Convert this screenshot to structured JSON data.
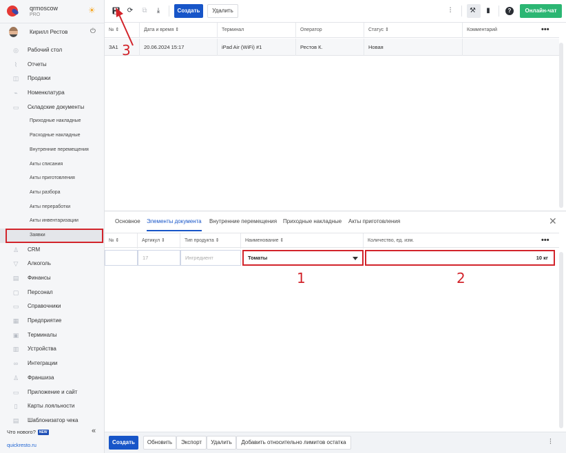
{
  "brand": {
    "name": "qrmoscow",
    "plan": "PRO"
  },
  "user": {
    "name": "Кирилл Рестов"
  },
  "sidebar": {
    "items": [
      {
        "label": "Рабочий стол",
        "icon": "◎",
        "sub": false
      },
      {
        "label": "Отчеты",
        "icon": "⌇",
        "sub": false
      },
      {
        "label": "Продажи",
        "icon": "◫",
        "sub": false
      },
      {
        "label": "Номенклатура",
        "icon": "⌁",
        "sub": false
      },
      {
        "label": "Складские документы",
        "icon": "▭",
        "sub": false
      },
      {
        "label": "Приходные накладные",
        "icon": "",
        "sub": true
      },
      {
        "label": "Расходные накладные",
        "icon": "",
        "sub": true
      },
      {
        "label": "Внутренние перемещения",
        "icon": "",
        "sub": true
      },
      {
        "label": "Акты списания",
        "icon": "",
        "sub": true
      },
      {
        "label": "Акты приготовления",
        "icon": "",
        "sub": true
      },
      {
        "label": "Акты разбора",
        "icon": "",
        "sub": true
      },
      {
        "label": "Акты переработки",
        "icon": "",
        "sub": true
      },
      {
        "label": "Акты инвентаризации",
        "icon": "",
        "sub": true
      },
      {
        "label": "Заявки",
        "icon": "",
        "sub": true,
        "active": true
      },
      {
        "label": "CRM",
        "icon": "♙",
        "sub": false
      },
      {
        "label": "Алкоголь",
        "icon": "▽",
        "sub": false
      },
      {
        "label": "Финансы",
        "icon": "▤",
        "sub": false
      },
      {
        "label": "Персонал",
        "icon": "▢",
        "sub": false
      },
      {
        "label": "Справочники",
        "icon": "▭",
        "sub": false
      },
      {
        "label": "Предприятие",
        "icon": "▦",
        "sub": false
      },
      {
        "label": "Терминалы",
        "icon": "▣",
        "sub": false
      },
      {
        "label": "Устройства",
        "icon": "▥",
        "sub": false
      },
      {
        "label": "Интеграции",
        "icon": "∞",
        "sub": false
      },
      {
        "label": "Франшиза",
        "icon": "♙",
        "sub": false
      },
      {
        "label": "Приложение и сайт",
        "icon": "▭",
        "sub": false
      },
      {
        "label": "Карты лояльности",
        "icon": "▯",
        "sub": false
      },
      {
        "label": "Шаблонизатор чека",
        "icon": "▤",
        "sub": false
      }
    ],
    "whats_new": "Что нового?",
    "new_badge": "NEW",
    "site_link": "quickresto.ru"
  },
  "toolbar": {
    "create_label": "Создать",
    "delete_label": "Удалить",
    "chat_label": "Онлайн-чат"
  },
  "grid": {
    "headers": [
      "№ ⇕",
      "Дата и время ⇕",
      "Терминал",
      "Оператор",
      "Статус ⇕",
      "Комментарий"
    ],
    "row": [
      "ЗА1",
      "20.06.2024 15:17",
      "iPad Air (WiFi) #1",
      "Рестов К.",
      "Новая",
      ""
    ]
  },
  "tabs": [
    "Основное",
    "Элементы документа",
    "Внутренние перемещения",
    "Приходные накладные",
    "Акты приготовления"
  ],
  "subgrid": {
    "headers": [
      "№ ⇕",
      "Артикул ⇕",
      "Тип продукта ⇕",
      "Наименование ⇕",
      "Количество, ед. изм."
    ],
    "row": {
      "num": "",
      "article": "17",
      "type": "Ингредиент",
      "name": "Томаты",
      "quantity": "10 кг"
    }
  },
  "annotations": {
    "a1": "1",
    "a2": "2",
    "a3": "3"
  },
  "footer": {
    "create_label": "Создать",
    "refresh_label": "Обновить",
    "export_label": "Экспорт",
    "delete_label": "Удалить",
    "add_limits_label": "Добавить относительно лимитов остатка"
  },
  "colors": {
    "primary": "#1755c8",
    "green": "#2bb673",
    "annotation": "#d2232a"
  }
}
